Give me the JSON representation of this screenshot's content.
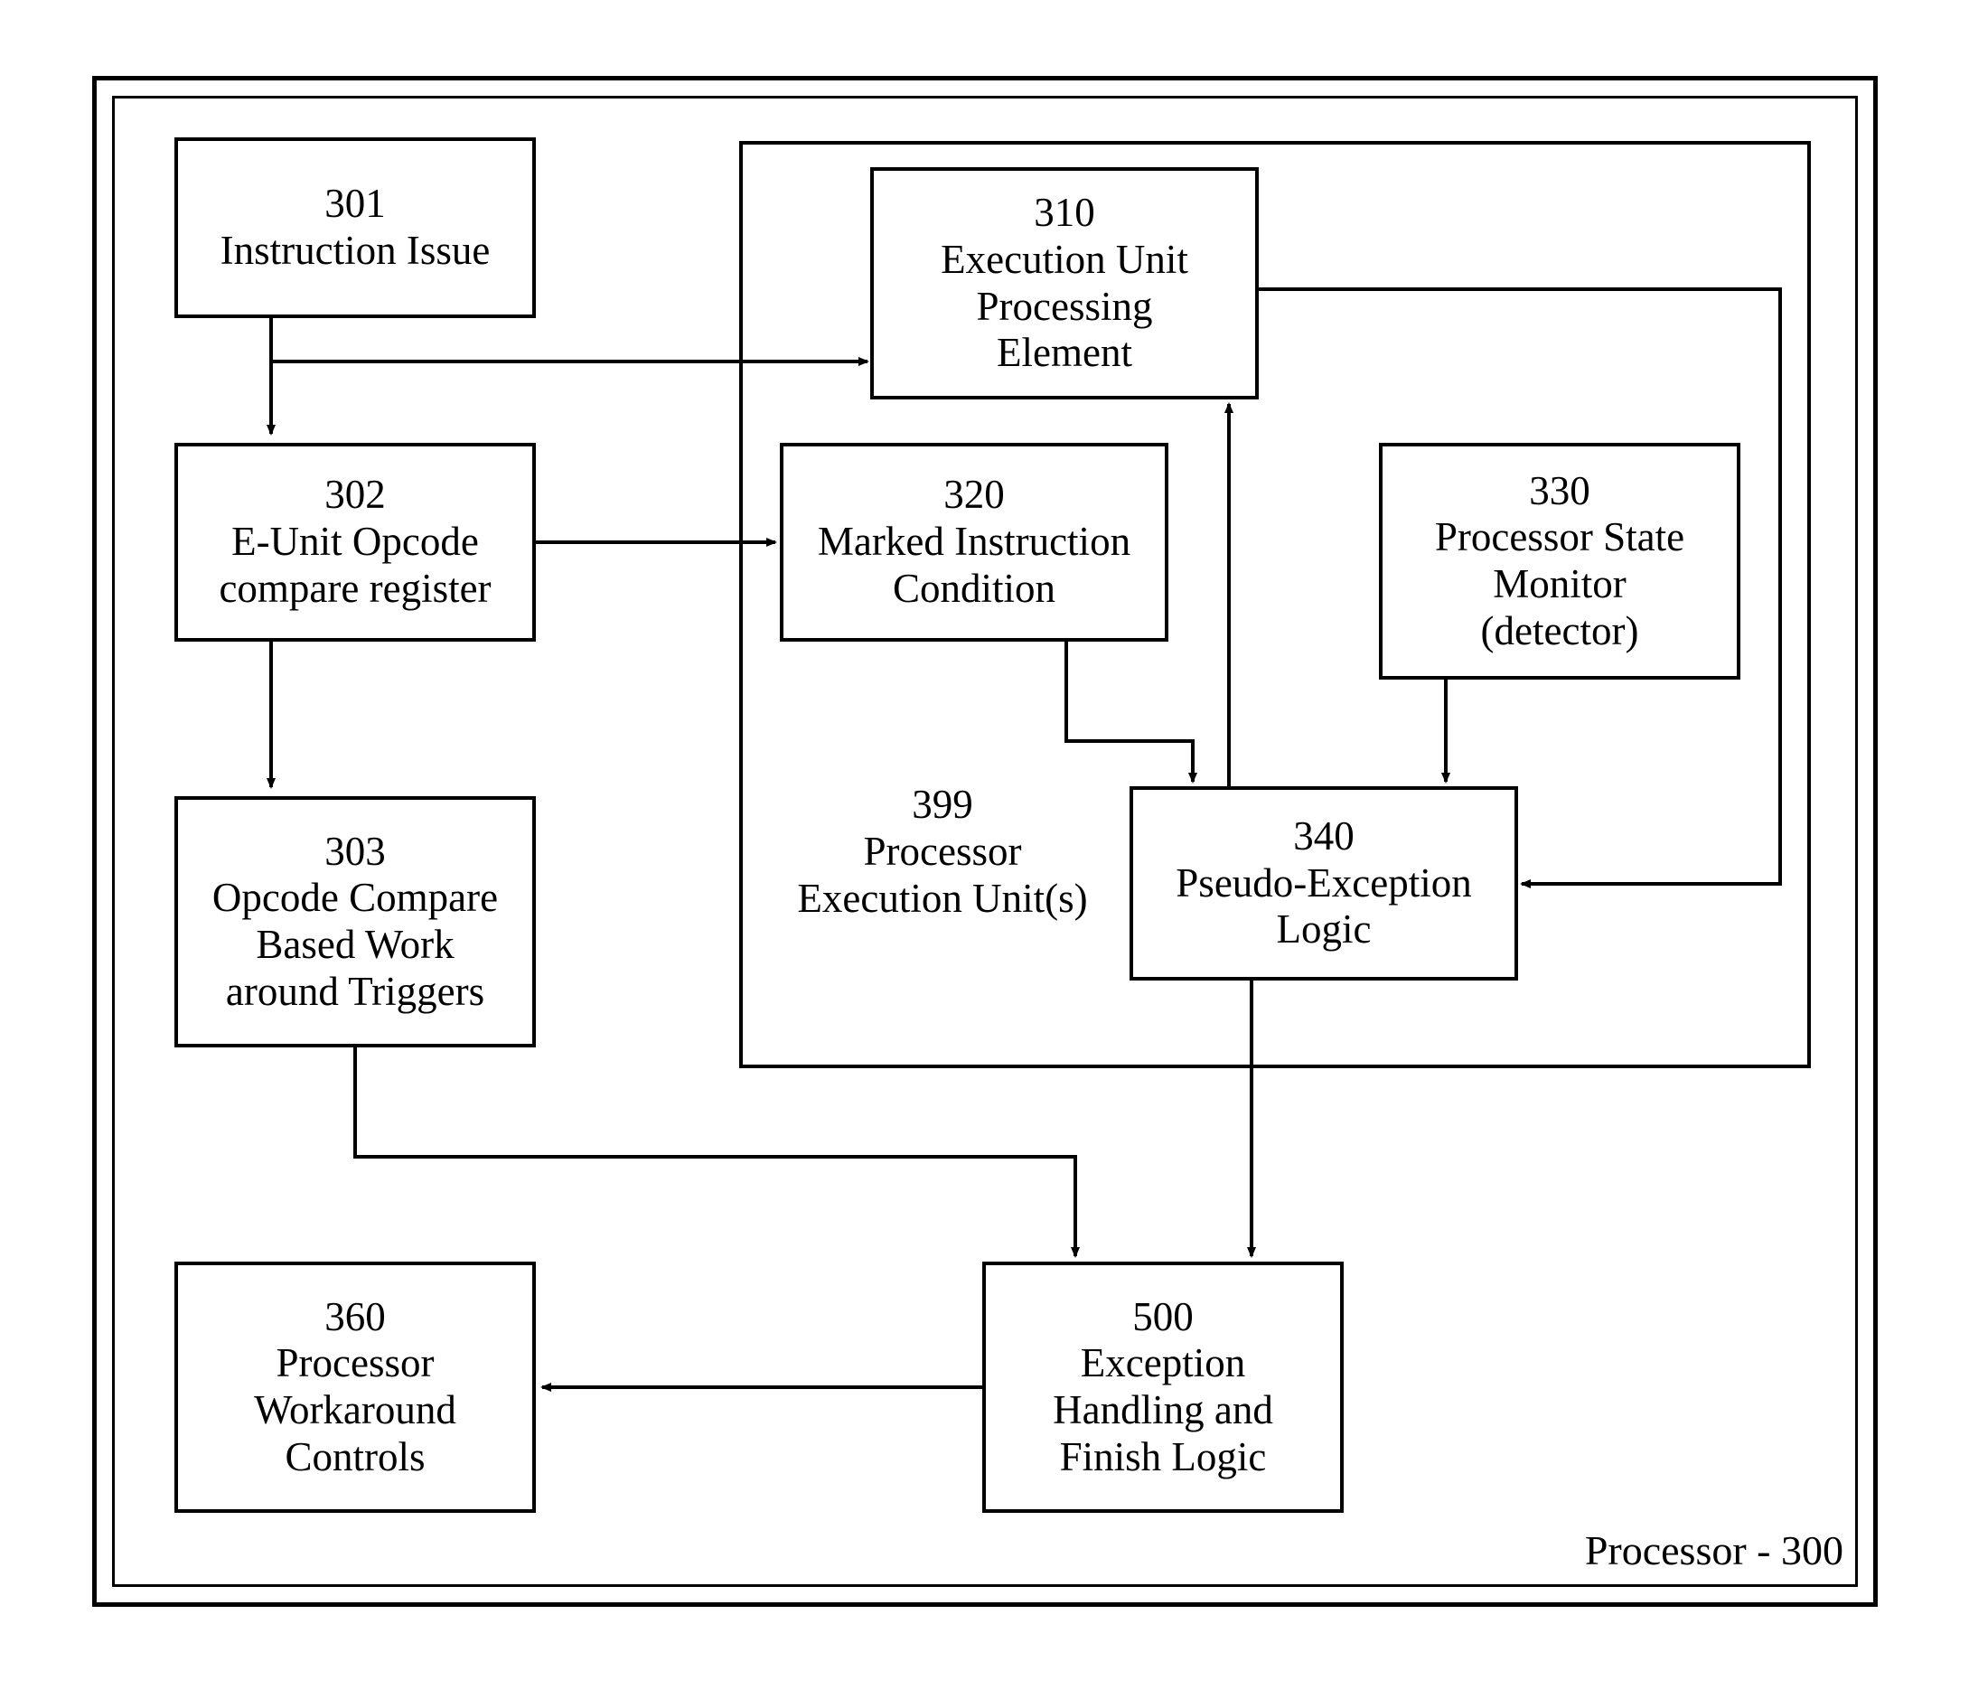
{
  "processor": {
    "caption_label": "Processor -",
    "caption_num": "300"
  },
  "boxes": {
    "b301": {
      "num": "301",
      "text": "Instruction Issue"
    },
    "b302": {
      "num": "302",
      "text1": "E-Unit Opcode",
      "text2": "compare register"
    },
    "b303": {
      "num": "303",
      "text1": "Opcode Compare",
      "text2": "Based Work",
      "text3": "around Triggers"
    },
    "b310": {
      "num": "310",
      "text1": "Execution Unit",
      "text2": "Processing",
      "text3": "Element"
    },
    "b320": {
      "num": "320",
      "text1": "Marked Instruction",
      "text2": "Condition"
    },
    "b330": {
      "num": "330",
      "text1": "Processor State",
      "text2": "Monitor",
      "text3": "(detector)"
    },
    "b340": {
      "num": "340",
      "text1": "Pseudo-Exception",
      "text2": "Logic"
    },
    "b399": {
      "num": "399",
      "text1": "Processor",
      "text2": "Execution Unit(s)"
    },
    "b360": {
      "num": "360",
      "text1": "Processor",
      "text2": "Workaround",
      "text3": "Controls"
    },
    "b500": {
      "num": "500",
      "text1": "Exception",
      "text2": "Handling and",
      "text3": "Finish Logic"
    }
  }
}
